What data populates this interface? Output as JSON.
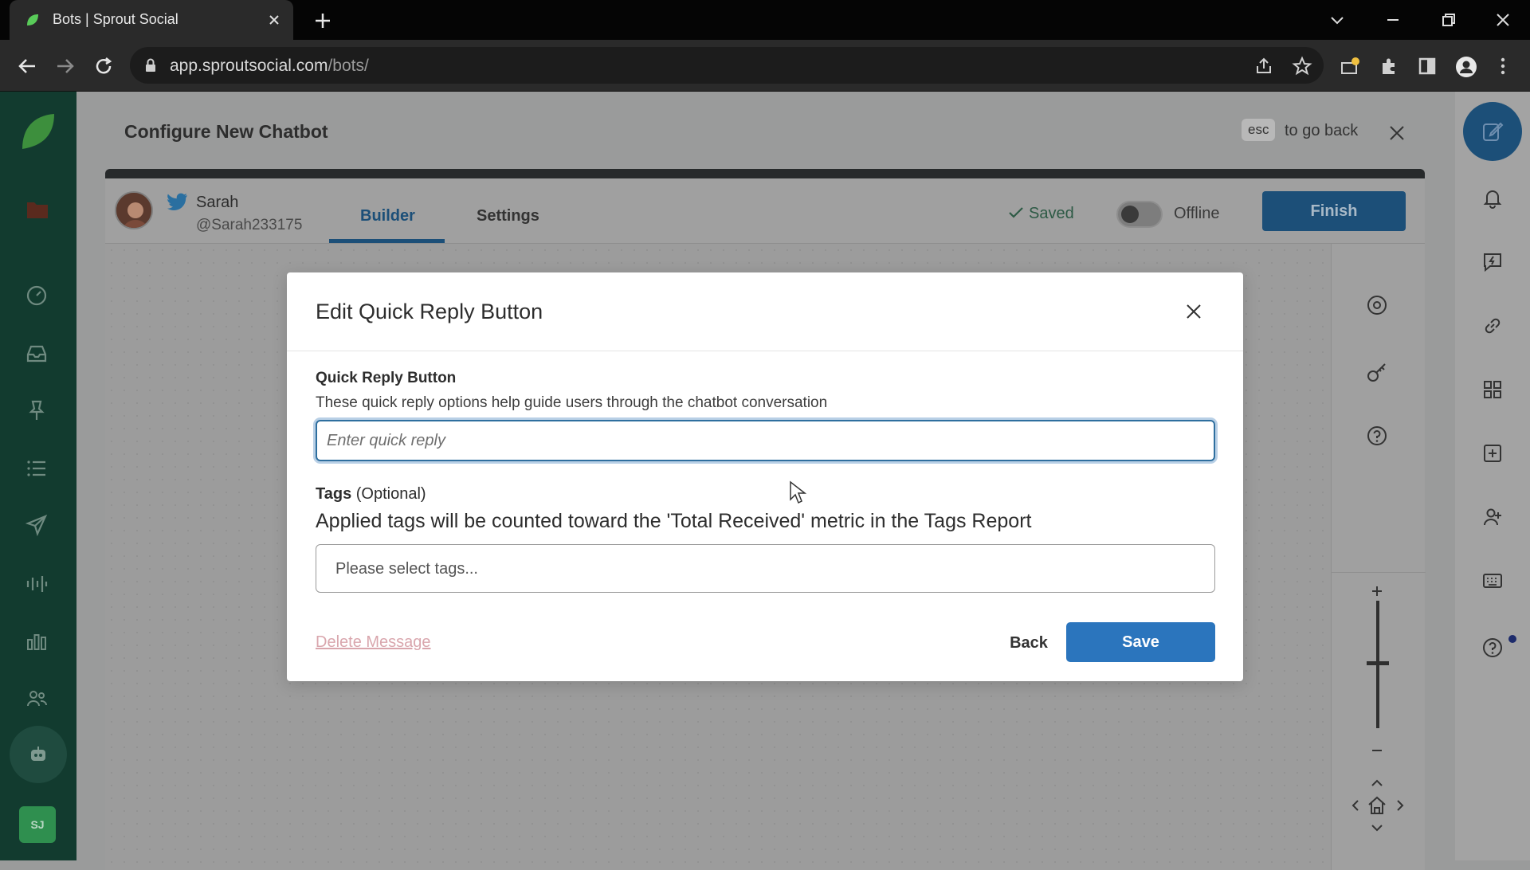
{
  "browser": {
    "tab_title": "Bots | Sprout Social",
    "url_host": "app.sproutsocial.com",
    "url_path": "/bots/"
  },
  "header": {
    "title": "Configure New Chatbot",
    "esc_key": "esc",
    "esc_hint": "to go back"
  },
  "profile": {
    "name": "Sarah",
    "handle": "@Sarah233175"
  },
  "builder_tabs": {
    "builder": "Builder",
    "settings": "Settings"
  },
  "status": {
    "saved": "Saved",
    "offline": "Offline",
    "finish": "Finish"
  },
  "sidebar": {
    "user_initials": "SJ"
  },
  "modal": {
    "title": "Edit Quick Reply Button",
    "field_label": "Quick Reply Button",
    "field_help": "These quick reply options help guide users through the chatbot conversation",
    "input_placeholder": "Enter quick reply",
    "input_value": "",
    "tags_label": "Tags",
    "tags_optional": "(Optional)",
    "tags_help": "Applied tags will be counted toward the 'Total Received' metric in the Tags Report",
    "tags_placeholder": "Please select tags...",
    "delete_label": "Delete Message",
    "back_label": "Back",
    "save_label": "Save"
  },
  "colors": {
    "brand_green": "#59cb59",
    "primary_blue": "#2b75bd",
    "nav_dark": "#123b2f"
  }
}
